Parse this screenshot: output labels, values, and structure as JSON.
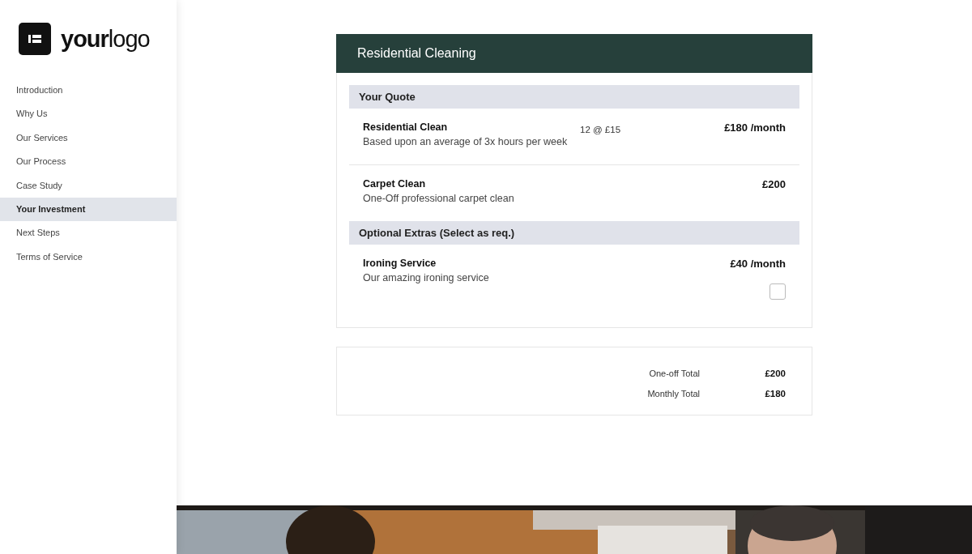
{
  "logo": {
    "text": "**your**logo"
  },
  "sidebar": {
    "items": [
      {
        "label": "Introduction",
        "selected": false
      },
      {
        "label": "Why Us",
        "selected": false
      },
      {
        "label": "Our Services",
        "selected": false
      },
      {
        "label": "Our Process",
        "selected": false
      },
      {
        "label": "Case Study",
        "selected": false
      },
      {
        "label": "Your Investment",
        "selected": true
      },
      {
        "label": "Next Steps",
        "selected": false
      },
      {
        "label": "Terms of Service",
        "selected": false
      }
    ]
  },
  "quote": {
    "title": "Residential Cleaning",
    "sections": [
      {
        "heading": "Your Quote",
        "items": [
          {
            "name": "Residential Clean",
            "description": "Based upon an average of 3x hours per week",
            "rate": "12 @ £15",
            "price": "£180 /month"
          },
          {
            "name": "Carpet Clean",
            "description": "One-Off professional carpet clean",
            "price": "£200"
          }
        ]
      },
      {
        "heading": "Optional Extras (Select as req.)",
        "items": [
          {
            "name": "Ironing Service",
            "description": "Our amazing ironing service",
            "price": "£40 /month",
            "checked": false
          }
        ]
      }
    ]
  },
  "totals": [
    {
      "label": "One-off Total",
      "value": "£200"
    },
    {
      "label": "Monthly Total",
      "value": "£180"
    }
  ]
}
